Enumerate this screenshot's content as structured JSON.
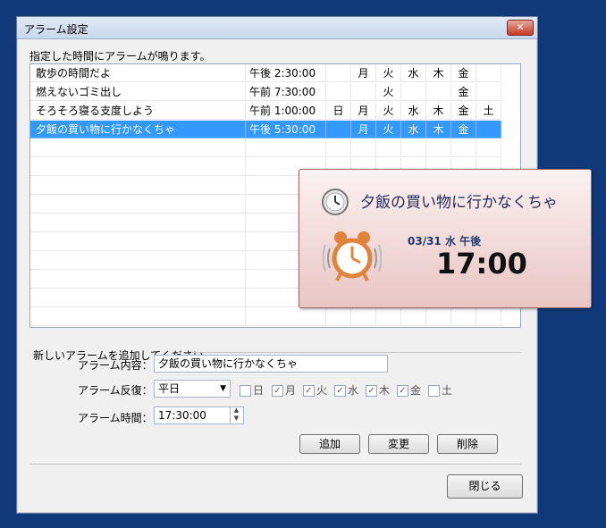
{
  "window": {
    "title": "アラーム設定",
    "close_label": "✕"
  },
  "list": {
    "caption": "指定した時間にアラームが鳴ります。",
    "rows": [
      {
        "name": "散歩の時間だよ",
        "time": "午後 2:30:00",
        "days": [
          "",
          "月",
          "火",
          "水",
          "木",
          "金",
          ""
        ],
        "selected": false
      },
      {
        "name": "燃えないゴミ出し",
        "time": "午前 7:30:00",
        "days": [
          "",
          "",
          "火",
          "",
          "",
          "金",
          ""
        ],
        "selected": false
      },
      {
        "name": "そろそろ寝る支度しよう",
        "time": "午前 1:00:00",
        "days": [
          "日",
          "月",
          "火",
          "水",
          "木",
          "金",
          "土"
        ],
        "selected": false
      },
      {
        "name": "夕飯の買い物に行かなくちゃ",
        "time": "午後 5:30:00",
        "days": [
          "",
          "月",
          "火",
          "水",
          "木",
          "金",
          ""
        ],
        "selected": true
      }
    ]
  },
  "popup": {
    "icon": "clock-icon",
    "title": "夕飯の買い物に行かなくちゃ",
    "date": "03/31 水 午後",
    "time": "17:00",
    "alarm_icon": "alarm-clock-icon"
  },
  "form": {
    "section_label": "新しいアラームを追加してください。",
    "content_label": "アラーム内容：",
    "content_value": "夕飯の買い物に行かなくちゃ",
    "repeat_label": "アラーム反復：",
    "repeat_value": "平日",
    "days": [
      {
        "label": "日",
        "checked": false
      },
      {
        "label": "月",
        "checked": true
      },
      {
        "label": "火",
        "checked": true
      },
      {
        "label": "水",
        "checked": true
      },
      {
        "label": "木",
        "checked": true
      },
      {
        "label": "金",
        "checked": true
      },
      {
        "label": "土",
        "checked": false
      }
    ],
    "time_label": "アラーム時間：",
    "time_value": "17:30:00"
  },
  "buttons": {
    "add": "追加",
    "edit": "変更",
    "delete": "削除",
    "close": "閉じる"
  },
  "colors": {
    "selection": "#3399ff",
    "desktop": "#10397a",
    "popup_accent": "#e0843c"
  }
}
